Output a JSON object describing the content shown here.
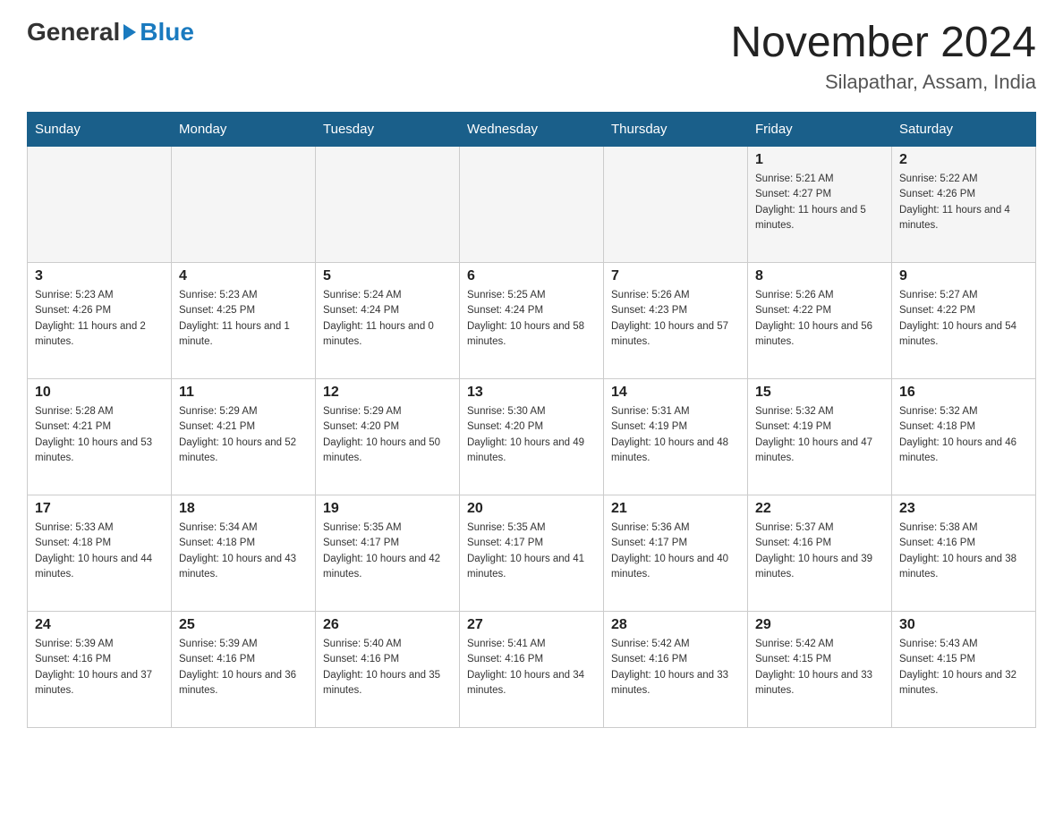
{
  "header": {
    "logo_general": "General",
    "logo_blue": "Blue",
    "title": "November 2024",
    "subtitle": "Silapathar, Assam, India"
  },
  "days_of_week": [
    "Sunday",
    "Monday",
    "Tuesday",
    "Wednesday",
    "Thursday",
    "Friday",
    "Saturday"
  ],
  "weeks": [
    [
      {
        "day": "",
        "info": ""
      },
      {
        "day": "",
        "info": ""
      },
      {
        "day": "",
        "info": ""
      },
      {
        "day": "",
        "info": ""
      },
      {
        "day": "",
        "info": ""
      },
      {
        "day": "1",
        "info": "Sunrise: 5:21 AM\nSunset: 4:27 PM\nDaylight: 11 hours and 5 minutes."
      },
      {
        "day": "2",
        "info": "Sunrise: 5:22 AM\nSunset: 4:26 PM\nDaylight: 11 hours and 4 minutes."
      }
    ],
    [
      {
        "day": "3",
        "info": "Sunrise: 5:23 AM\nSunset: 4:26 PM\nDaylight: 11 hours and 2 minutes."
      },
      {
        "day": "4",
        "info": "Sunrise: 5:23 AM\nSunset: 4:25 PM\nDaylight: 11 hours and 1 minute."
      },
      {
        "day": "5",
        "info": "Sunrise: 5:24 AM\nSunset: 4:24 PM\nDaylight: 11 hours and 0 minutes."
      },
      {
        "day": "6",
        "info": "Sunrise: 5:25 AM\nSunset: 4:24 PM\nDaylight: 10 hours and 58 minutes."
      },
      {
        "day": "7",
        "info": "Sunrise: 5:26 AM\nSunset: 4:23 PM\nDaylight: 10 hours and 57 minutes."
      },
      {
        "day": "8",
        "info": "Sunrise: 5:26 AM\nSunset: 4:22 PM\nDaylight: 10 hours and 56 minutes."
      },
      {
        "day": "9",
        "info": "Sunrise: 5:27 AM\nSunset: 4:22 PM\nDaylight: 10 hours and 54 minutes."
      }
    ],
    [
      {
        "day": "10",
        "info": "Sunrise: 5:28 AM\nSunset: 4:21 PM\nDaylight: 10 hours and 53 minutes."
      },
      {
        "day": "11",
        "info": "Sunrise: 5:29 AM\nSunset: 4:21 PM\nDaylight: 10 hours and 52 minutes."
      },
      {
        "day": "12",
        "info": "Sunrise: 5:29 AM\nSunset: 4:20 PM\nDaylight: 10 hours and 50 minutes."
      },
      {
        "day": "13",
        "info": "Sunrise: 5:30 AM\nSunset: 4:20 PM\nDaylight: 10 hours and 49 minutes."
      },
      {
        "day": "14",
        "info": "Sunrise: 5:31 AM\nSunset: 4:19 PM\nDaylight: 10 hours and 48 minutes."
      },
      {
        "day": "15",
        "info": "Sunrise: 5:32 AM\nSunset: 4:19 PM\nDaylight: 10 hours and 47 minutes."
      },
      {
        "day": "16",
        "info": "Sunrise: 5:32 AM\nSunset: 4:18 PM\nDaylight: 10 hours and 46 minutes."
      }
    ],
    [
      {
        "day": "17",
        "info": "Sunrise: 5:33 AM\nSunset: 4:18 PM\nDaylight: 10 hours and 44 minutes."
      },
      {
        "day": "18",
        "info": "Sunrise: 5:34 AM\nSunset: 4:18 PM\nDaylight: 10 hours and 43 minutes."
      },
      {
        "day": "19",
        "info": "Sunrise: 5:35 AM\nSunset: 4:17 PM\nDaylight: 10 hours and 42 minutes."
      },
      {
        "day": "20",
        "info": "Sunrise: 5:35 AM\nSunset: 4:17 PM\nDaylight: 10 hours and 41 minutes."
      },
      {
        "day": "21",
        "info": "Sunrise: 5:36 AM\nSunset: 4:17 PM\nDaylight: 10 hours and 40 minutes."
      },
      {
        "day": "22",
        "info": "Sunrise: 5:37 AM\nSunset: 4:16 PM\nDaylight: 10 hours and 39 minutes."
      },
      {
        "day": "23",
        "info": "Sunrise: 5:38 AM\nSunset: 4:16 PM\nDaylight: 10 hours and 38 minutes."
      }
    ],
    [
      {
        "day": "24",
        "info": "Sunrise: 5:39 AM\nSunset: 4:16 PM\nDaylight: 10 hours and 37 minutes."
      },
      {
        "day": "25",
        "info": "Sunrise: 5:39 AM\nSunset: 4:16 PM\nDaylight: 10 hours and 36 minutes."
      },
      {
        "day": "26",
        "info": "Sunrise: 5:40 AM\nSunset: 4:16 PM\nDaylight: 10 hours and 35 minutes."
      },
      {
        "day": "27",
        "info": "Sunrise: 5:41 AM\nSunset: 4:16 PM\nDaylight: 10 hours and 34 minutes."
      },
      {
        "day": "28",
        "info": "Sunrise: 5:42 AM\nSunset: 4:16 PM\nDaylight: 10 hours and 33 minutes."
      },
      {
        "day": "29",
        "info": "Sunrise: 5:42 AM\nSunset: 4:15 PM\nDaylight: 10 hours and 33 minutes."
      },
      {
        "day": "30",
        "info": "Sunrise: 5:43 AM\nSunset: 4:15 PM\nDaylight: 10 hours and 32 minutes."
      }
    ]
  ]
}
